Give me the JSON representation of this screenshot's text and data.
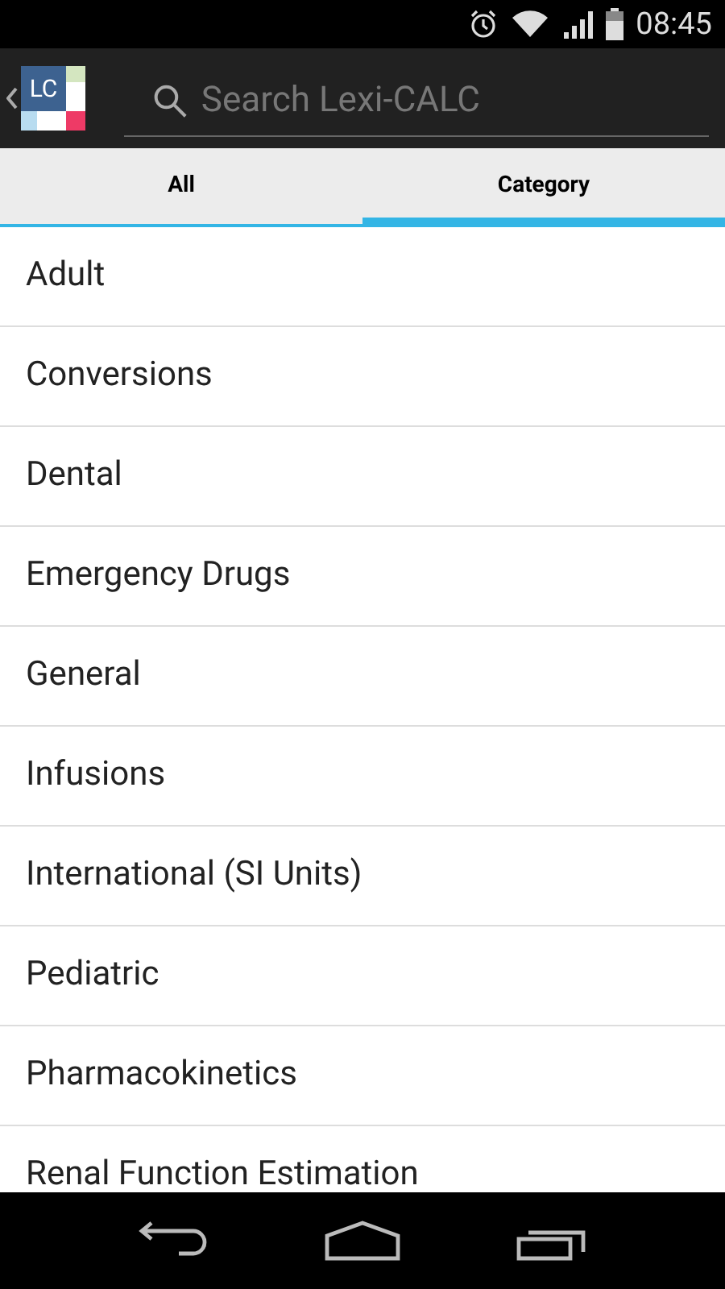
{
  "status_bar": {
    "time": "08:45"
  },
  "action_bar": {
    "logo_text": "LC",
    "search": {
      "placeholder": "Search Lexi-CALC"
    }
  },
  "tabs": [
    {
      "label": "All",
      "selected": false
    },
    {
      "label": "Category",
      "selected": true
    }
  ],
  "categories": [
    "Adult",
    "Conversions",
    "Dental",
    "Emergency Drugs",
    "General",
    "Infusions",
    "International (SI Units)",
    "Pediatric",
    "Pharmacokinetics",
    "Renal Function Estimation"
  ]
}
